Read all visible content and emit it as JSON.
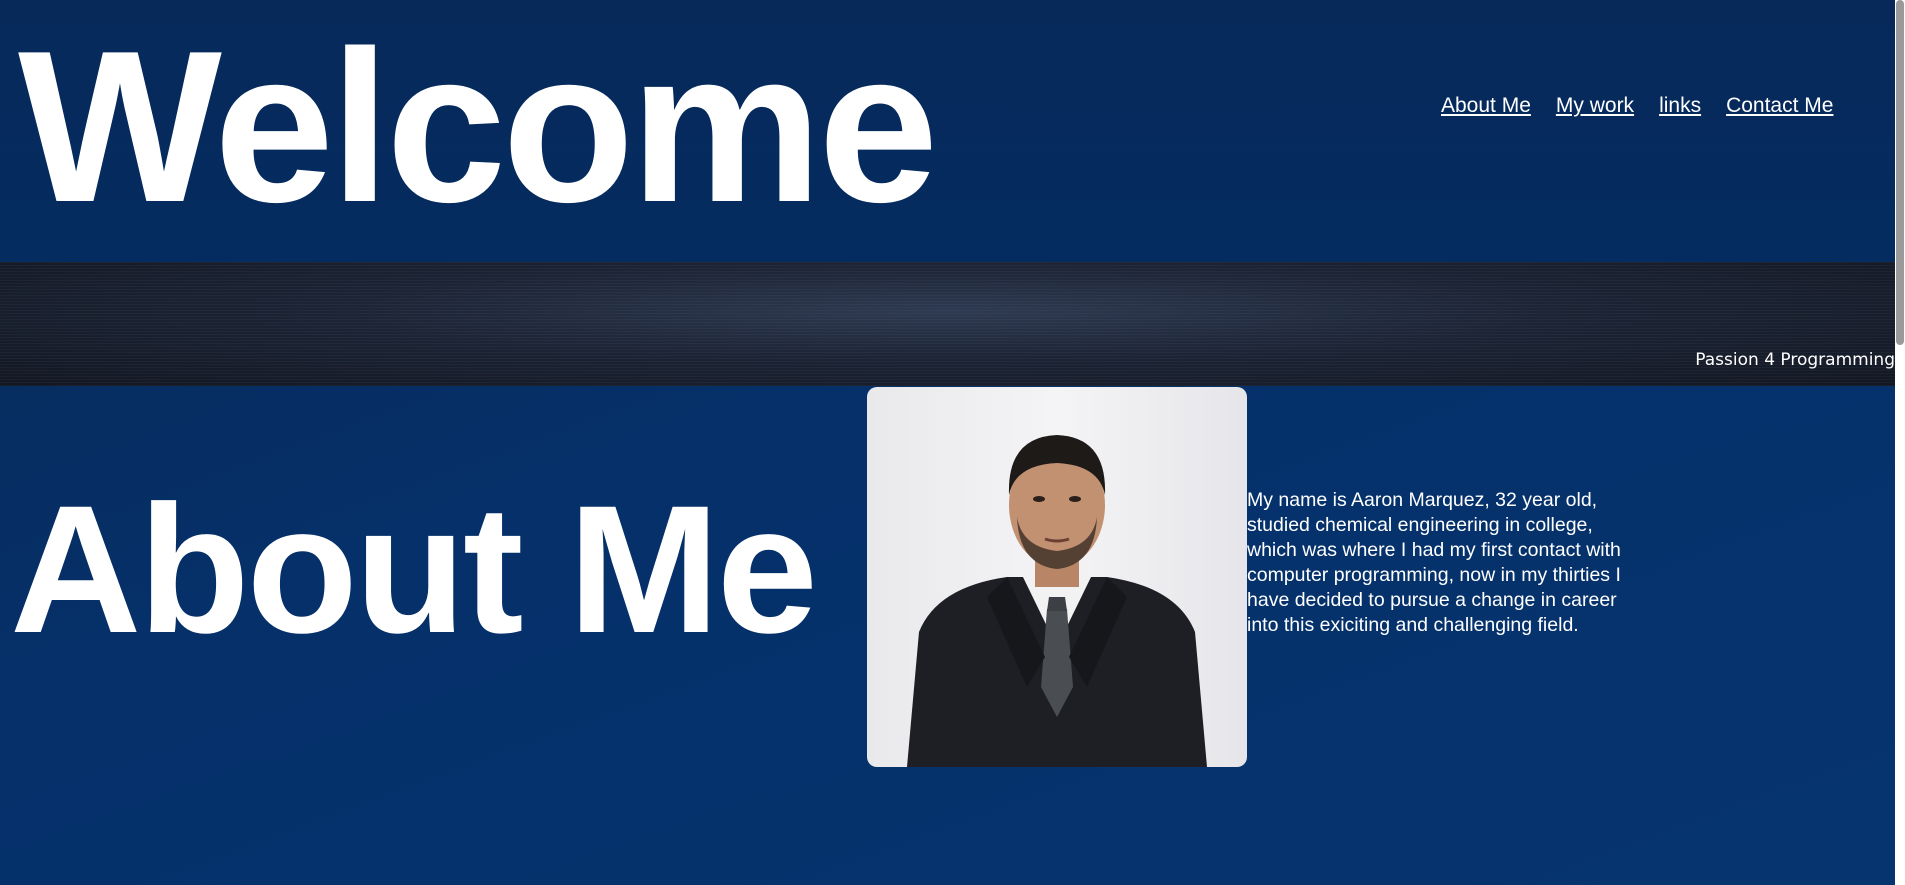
{
  "header": {
    "title": "Welcome",
    "nav": [
      {
        "label": "About Me"
      },
      {
        "label": "My work"
      },
      {
        "label": "links"
      },
      {
        "label": "Contact Me"
      }
    ]
  },
  "banner": {
    "tagline": "Passion 4 Programming"
  },
  "about": {
    "title": "About Me",
    "photo_alt": "Portrait photo",
    "bio": "My name is Aaron Marquez, 32 year old, studied chemical engineering in college, which was where I had my first contact with computer programming, now in my thirties I have decided to pursue a change in career into this exiciting and challenging field."
  },
  "colors": {
    "background": "#05306a",
    "banner": "#1c2435",
    "text": "#ffffff"
  }
}
